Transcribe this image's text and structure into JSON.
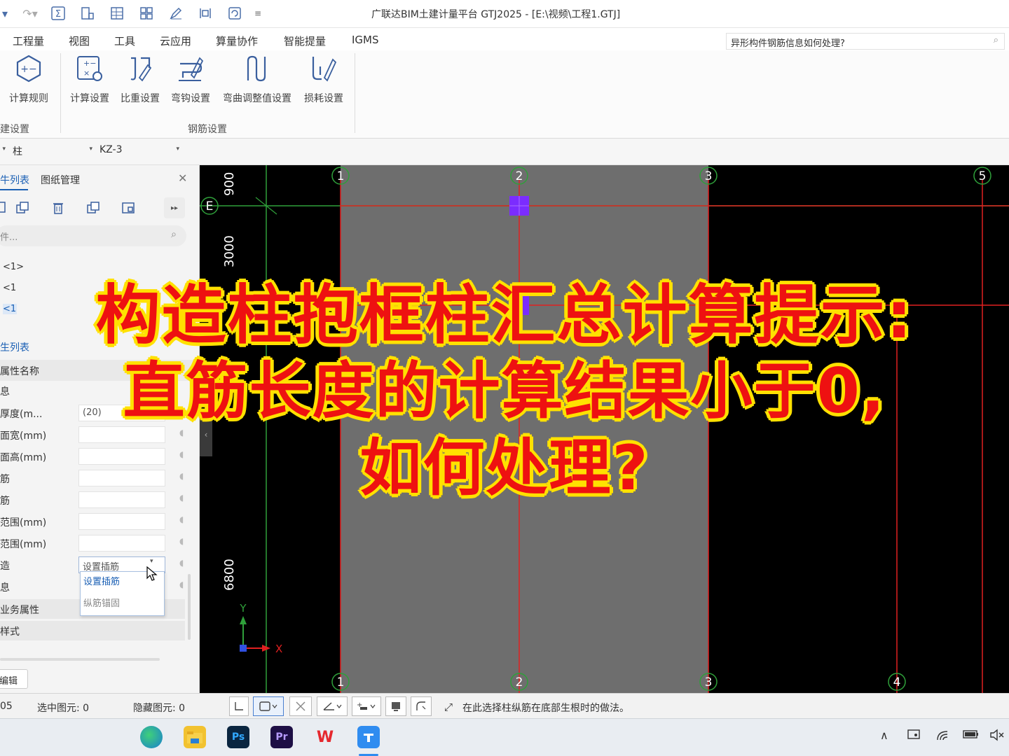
{
  "window": {
    "title": "广联达BIM土建计量平台 GTJ2025 - [E:\\视频\\工程1.GTJ]"
  },
  "menu": {
    "items": [
      "工程量",
      "视图",
      "工具",
      "云应用",
      "算量协作",
      "智能提量",
      "IGMS"
    ],
    "help_search": "异形构件钢筋信息如何处理?"
  },
  "ribbon": {
    "buttons": [
      "计算规则",
      "计算设置",
      "比重设置",
      "弯钩设置",
      "弯曲调整值设置",
      "损耗设置"
    ],
    "groups": [
      "建设置",
      "钢筋设置"
    ]
  },
  "selector": {
    "type": "柱",
    "component": "KZ-3"
  },
  "left_panel": {
    "tabs": [
      "牛列表",
      "图纸管理"
    ],
    "search_placeholder": "件...",
    "tree_items": [
      "<1>",
      "<1",
      "<1"
    ],
    "prop_tabs": [
      "生列表"
    ],
    "prop_header": "属性名称",
    "props": [
      {
        "name": "息",
        "value": ""
      },
      {
        "name": "厚度(m...",
        "value": "(20)"
      },
      {
        "name": "面宽(mm)",
        "value": ""
      },
      {
        "name": "面高(mm)",
        "value": ""
      },
      {
        "name": "筋",
        "value": ""
      },
      {
        "name": "筋",
        "value": ""
      },
      {
        "name": "范围(mm)",
        "value": ""
      },
      {
        "name": "范围(mm)",
        "value": ""
      },
      {
        "name": "造",
        "value": "设置插筋"
      },
      {
        "name": "息",
        "value": ""
      }
    ],
    "dropdown_options": [
      "设置插筋",
      "纵筋锚固"
    ],
    "sections": [
      "业务属性",
      "样式"
    ],
    "edit_button": "编辑"
  },
  "canvas": {
    "axes_top": [
      "1",
      "2",
      "3",
      "5"
    ],
    "axes_bottom": [
      "1",
      "2",
      "3",
      "4"
    ],
    "axis_row": "E",
    "dims": [
      "900",
      "3000",
      "6800"
    ],
    "coord_x": "X",
    "coord_y": "Y"
  },
  "status": {
    "layer": "05",
    "selected": "选中图元: 0",
    "hidden": "隐藏图元: 0",
    "hint": "在此选择柱纵筋在底部生根时的做法。"
  },
  "taskbar": {
    "apps": [
      "Ps",
      "Pr",
      "W"
    ]
  },
  "overlay": {
    "line1": "构造柱抱框柱汇总计算提示:",
    "line2": "直筋长度的计算结果小于0,",
    "line3": "如何处理?"
  },
  "colors": {
    "canvas_bg": "#000000",
    "column_band": "#6e6e6e",
    "axis_red": "#e02020",
    "axis_green": "#2f9f3a",
    "caption_red": "#ee1111",
    "caption_outline": "#ffe100",
    "column_marker": "#7b2cff"
  }
}
